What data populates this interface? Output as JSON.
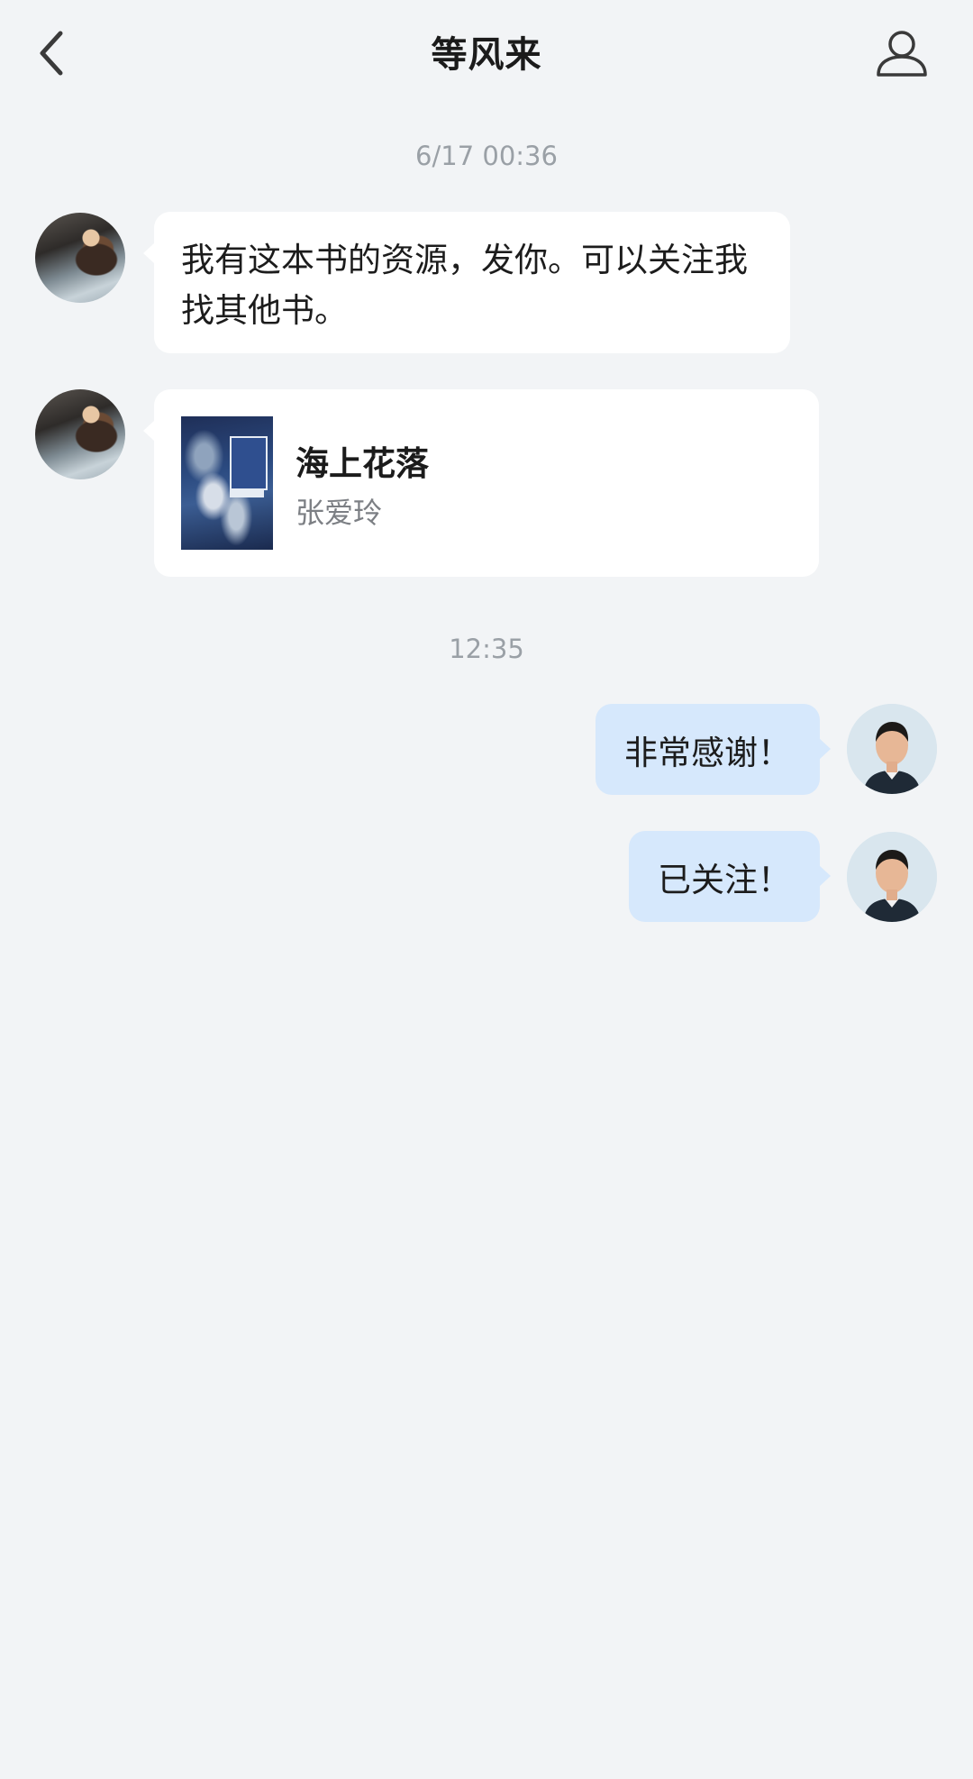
{
  "header": {
    "title": "等风来",
    "back_icon": "chevron-left-icon",
    "profile_icon": "person-icon"
  },
  "messages": [
    {
      "type": "timestamp",
      "text": "6/17 00:36"
    },
    {
      "type": "text",
      "sender": "other",
      "text": "我有这本书的资源，发你。可以关注我找其他书。"
    },
    {
      "type": "book",
      "sender": "other",
      "book": {
        "title": "海上花落",
        "author": "张爱玲"
      }
    },
    {
      "type": "timestamp",
      "text": "12:35"
    },
    {
      "type": "text",
      "sender": "self",
      "text": "非常感谢！"
    },
    {
      "type": "text",
      "sender": "self",
      "text": "已关注！"
    }
  ],
  "colors": {
    "background": "#f2f4f6",
    "incoming_bubble": "#ffffff",
    "outgoing_bubble": "#d6e8fc",
    "timestamp_text": "#9aa0a6"
  }
}
